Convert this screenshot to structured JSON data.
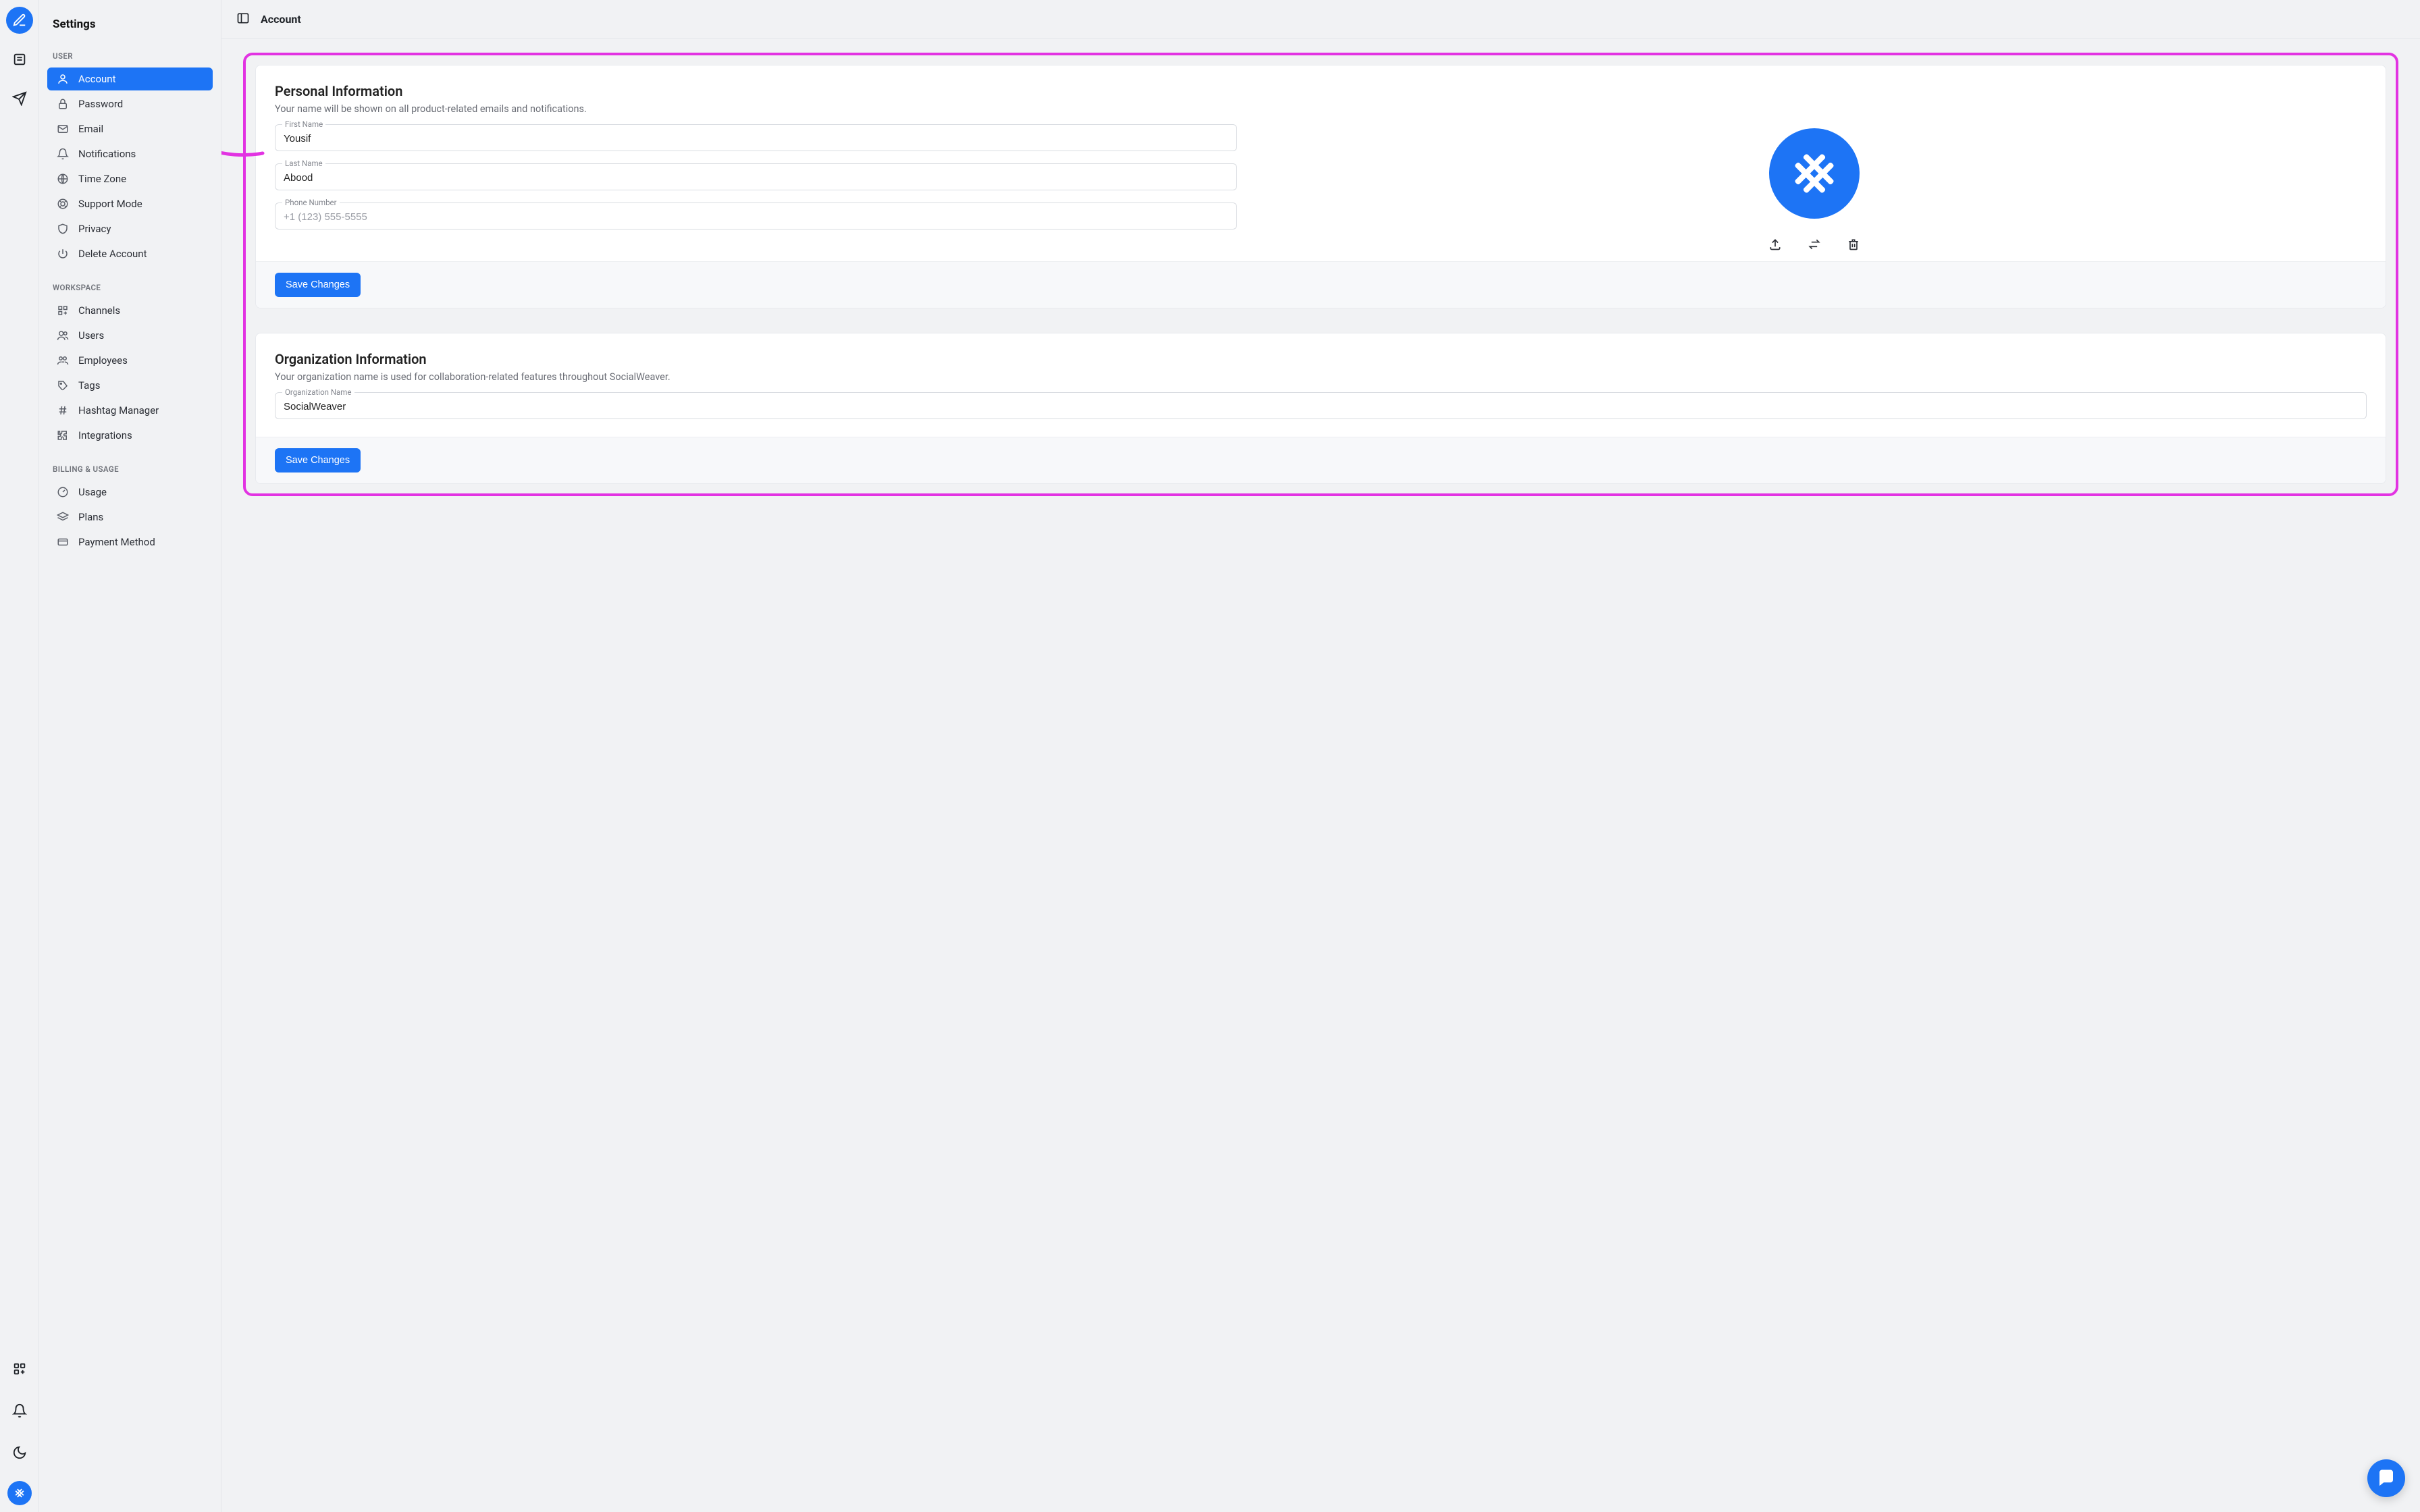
{
  "sidebar": {
    "title": "Settings",
    "sections": {
      "user": {
        "label": "USER",
        "items": [
          "Account",
          "Password",
          "Email",
          "Notifications",
          "Time Zone",
          "Support Mode",
          "Privacy",
          "Delete Account"
        ]
      },
      "workspace": {
        "label": "WORKSPACE",
        "items": [
          "Channels",
          "Users",
          "Employees",
          "Tags",
          "Hashtag Manager",
          "Integrations"
        ]
      },
      "billing": {
        "label": "BILLING & USAGE",
        "items": [
          "Usage",
          "Plans",
          "Payment Method"
        ]
      }
    }
  },
  "topbar": {
    "title": "Account"
  },
  "personal": {
    "title": "Personal Information",
    "desc": "Your name will be shown on all product-related emails and notifications.",
    "firstName": {
      "label": "First Name",
      "value": "Yousif"
    },
    "lastName": {
      "label": "Last Name",
      "value": "Abood"
    },
    "phone": {
      "label": "Phone Number",
      "placeholder": "+1 (123) 555-5555",
      "value": ""
    },
    "saveLabel": "Save Changes"
  },
  "org": {
    "title": "Organization Information",
    "desc": "Your organization name is used for collaboration-related features throughout SocialWeaver.",
    "name": {
      "label": "Organization Name",
      "value": "SocialWeaver"
    },
    "saveLabel": "Save Changes"
  },
  "icons": {
    "compose": "compose",
    "feed": "feed",
    "send": "send",
    "apps": "apps",
    "bell": "bell",
    "moon": "moon",
    "panel": "panel",
    "upload": "upload",
    "swap": "swap",
    "trash": "trash",
    "chat": "chat"
  },
  "colors": {
    "accent": "#1d74f5",
    "annotation": "#e233e2"
  }
}
